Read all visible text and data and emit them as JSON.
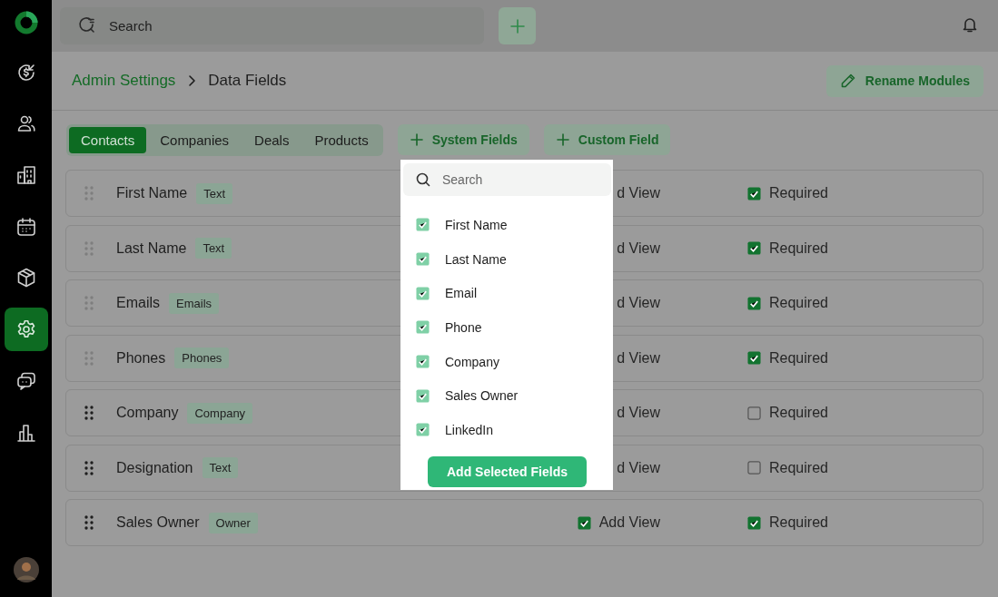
{
  "sidebar": {
    "items": [
      {
        "selected": false
      },
      {
        "selected": false
      },
      {
        "selected": false
      },
      {
        "selected": false
      },
      {
        "selected": false
      },
      {
        "selected": true
      },
      {
        "selected": false
      },
      {
        "selected": false
      }
    ]
  },
  "top_bar": {
    "search": {
      "placeholder": "Search"
    }
  },
  "breadcrumb": [
    "Admin Settings",
    "Data Fields"
  ],
  "rename_button": "Rename Modules",
  "tabs": [
    {
      "label": "Contacts",
      "selected": true
    },
    {
      "label": "Companies",
      "selected": false
    },
    {
      "label": "Deals",
      "selected": false
    },
    {
      "label": "Products",
      "selected": false
    }
  ],
  "actions": [
    "System Fields",
    "Custom Field"
  ],
  "fields": [
    {
      "name": "First Name",
      "type": "Text",
      "locked": true,
      "add_view": {
        "label": "d View"
      },
      "required": {
        "label": "Required",
        "checked": true
      }
    },
    {
      "name": "Last Name",
      "type": "Text",
      "locked": true,
      "add_view": {
        "label": "d View"
      },
      "required": {
        "label": "Required",
        "checked": true
      }
    },
    {
      "name": "Emails",
      "type": "Emails",
      "locked": true,
      "add_view": {
        "label": "d View"
      },
      "required": {
        "label": "Required",
        "checked": true
      }
    },
    {
      "name": "Phones",
      "type": "Phones",
      "locked": true,
      "add_view": {
        "label": "d View"
      },
      "required": {
        "label": "Required",
        "checked": true
      }
    },
    {
      "name": "Company",
      "type": "Company",
      "locked": false,
      "add_view": {
        "label": "d View"
      },
      "required": {
        "label": "Required",
        "checked": false
      }
    },
    {
      "name": "Designation",
      "type": "Text",
      "locked": false,
      "add_view": {
        "label": "d View"
      },
      "required": {
        "label": "Required",
        "checked": false
      }
    },
    {
      "name": "Sales Owner",
      "type": "Owner",
      "locked": false,
      "add_view": {
        "label": "Add View",
        "checked": true
      },
      "required": {
        "label": "Required",
        "checked": true
      }
    }
  ],
  "picker": {
    "search": {
      "placeholder": "Search"
    },
    "items": [
      {
        "label": "First Name",
        "checked": true
      },
      {
        "label": "Last Name",
        "checked": true
      },
      {
        "label": "Email",
        "checked": true
      },
      {
        "label": "Phone",
        "checked": true
      },
      {
        "label": "Company",
        "checked": true
      },
      {
        "label": "Sales Owner",
        "checked": true
      },
      {
        "label": "LinkedIn",
        "checked": true
      }
    ],
    "button": "Add Selected Fields"
  }
}
